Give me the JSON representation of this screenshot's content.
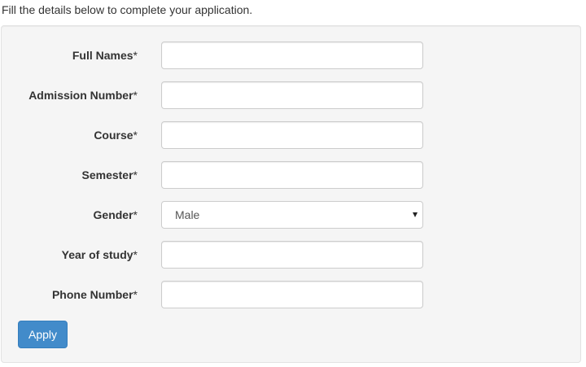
{
  "intro_text": "Fill the details below to complete your application.",
  "form": {
    "required_mark": "*",
    "fields": [
      {
        "label": "Full Names",
        "value": "",
        "type": "text"
      },
      {
        "label": "Admission Number",
        "value": "",
        "type": "text"
      },
      {
        "label": "Course",
        "value": "",
        "type": "text"
      },
      {
        "label": "Semester",
        "value": "",
        "type": "text"
      },
      {
        "label": "Gender",
        "value": "Male",
        "type": "select"
      },
      {
        "label": "Year of study",
        "value": "",
        "type": "text"
      },
      {
        "label": "Phone Number",
        "value": "",
        "type": "text"
      }
    ],
    "submit_label": "Apply"
  },
  "colors": {
    "button_bg": "#428bca",
    "panel_bg": "#f5f5f5",
    "input_border": "#cccccc"
  }
}
